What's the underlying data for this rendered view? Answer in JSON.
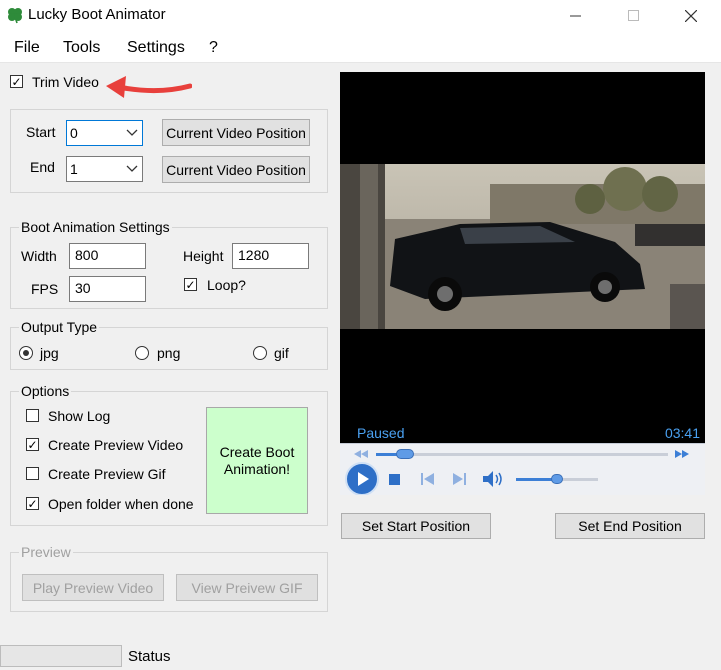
{
  "window": {
    "title": "Lucky Boot Animator"
  },
  "menu": [
    "File",
    "Tools",
    "Settings",
    "?"
  ],
  "trim": {
    "checkbox_label": "Trim Video",
    "checked": true,
    "start_label": "Start",
    "start_value": "0",
    "end_label": "End",
    "end_value": "1",
    "start_button": "Current Video Position",
    "end_button": "Current Video Position"
  },
  "boot_settings": {
    "title": "Boot Animation Settings",
    "width_label": "Width",
    "width_value": "800",
    "height_label": "Height",
    "height_value": "1280",
    "fps_label": "FPS",
    "fps_value": "30",
    "loop_label": "Loop?",
    "loop_checked": true
  },
  "output_type": {
    "title": "Output Type",
    "options": [
      "jpg",
      "png",
      "gif"
    ],
    "selected": "jpg"
  },
  "options": {
    "title": "Options",
    "items": [
      {
        "label": "Show Log",
        "checked": false
      },
      {
        "label": "Create Preview Video",
        "checked": true
      },
      {
        "label": "Create Preview Gif",
        "checked": false
      },
      {
        "label": "Open folder when done",
        "checked": true
      }
    ],
    "create_button": "Create Boot Animation!"
  },
  "preview": {
    "title": "Preview",
    "play_button": "Play Preview Video",
    "view_button": "View Preivew GIF"
  },
  "player": {
    "state": "Paused",
    "time": "03:41",
    "seek_fraction": 0.1,
    "volume_fraction": 0.5
  },
  "player_buttons": {
    "set_start": "Set Start Position",
    "set_end": "Set End Position"
  },
  "status": {
    "text": "Status"
  },
  "colors": {
    "accent": "#0078d7",
    "create_button_bg": "#ccffcc",
    "annotation_arrow": "#e8403c",
    "clover": "#2e8b3a"
  },
  "icons": [
    "clover-icon",
    "minimize-icon",
    "maximize-icon",
    "close-icon",
    "play-icon",
    "stop-icon",
    "previous-icon",
    "next-icon",
    "volume-icon",
    "rewind-icon",
    "fast-forward-icon",
    "dropdown-arrow-icon",
    "annotation-arrow"
  ]
}
